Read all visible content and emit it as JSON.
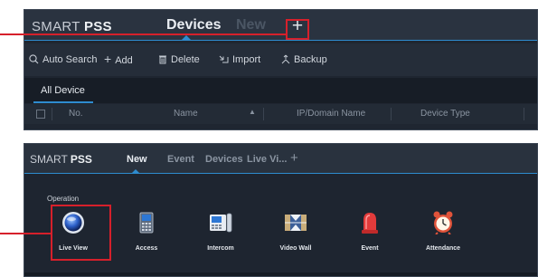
{
  "top_window": {
    "logo_prefix": "SMART ",
    "logo_bold": "PSS",
    "tabs": [
      {
        "label": "Devices",
        "active": true
      },
      {
        "label": "New",
        "active": false
      }
    ],
    "add_tab_symbol": "+",
    "toolbar": [
      {
        "icon": "search-icon",
        "label": "Auto Search"
      },
      {
        "icon": "plus-icon",
        "label": "Add"
      },
      {
        "icon": "trash-icon",
        "label": "Delete"
      },
      {
        "icon": "import-icon",
        "label": "Import"
      },
      {
        "icon": "backup-icon",
        "label": "Backup"
      }
    ],
    "list_tab": "All Device",
    "columns": [
      "No.",
      "Name",
      "IP/Domain Name",
      "Device Type"
    ]
  },
  "bottom_window": {
    "logo_prefix": "SMART ",
    "logo_bold": "PSS",
    "tabs": [
      {
        "label": "New",
        "active": true
      },
      {
        "label": "Event",
        "active": false
      },
      {
        "label": "Devices",
        "active": false
      },
      {
        "label": "Live Vi...",
        "active": false
      }
    ],
    "add_tab_symbol": "+",
    "section_title": "Operation",
    "apps": [
      {
        "icon": "live-view-icon",
        "label": "Live View"
      },
      {
        "icon": "access-icon",
        "label": "Access"
      },
      {
        "icon": "intercom-icon",
        "label": "Intercom"
      },
      {
        "icon": "video-wall-icon",
        "label": "Video Wall"
      },
      {
        "icon": "event-icon",
        "label": "Event"
      },
      {
        "icon": "attendance-icon",
        "label": "Attendance"
      }
    ]
  },
  "colors": {
    "accent": "#2e8ccf",
    "highlight": "#d6202b",
    "bg": "#1f2631"
  }
}
